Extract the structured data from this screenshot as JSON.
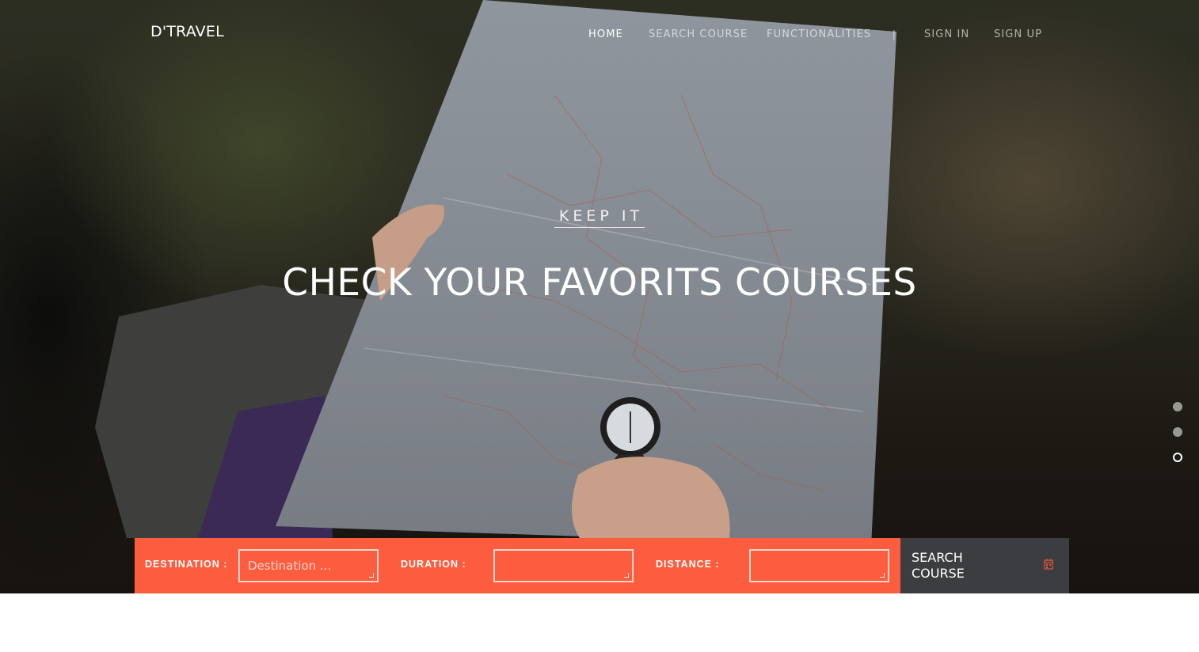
{
  "brand": {
    "logo": "D'TRAVEL"
  },
  "nav": {
    "items": [
      {
        "label": "HOME",
        "active": true
      },
      {
        "label": "SEARCH COURSE",
        "active": false
      },
      {
        "label": "FUNCTIONALITIES",
        "active": false
      }
    ],
    "separator": "|",
    "auth": [
      {
        "label": "SIGN IN"
      },
      {
        "label": "SIGN UP"
      }
    ]
  },
  "hero": {
    "eyebrow": "KEEP IT",
    "headline": "CHECK YOUR FAVORITS COURSES",
    "slides": {
      "count": 3,
      "active_index": 2
    }
  },
  "search": {
    "destination": {
      "label": "DESTINATION :",
      "placeholder": "Destination ...",
      "value": ""
    },
    "duration": {
      "label": "DURATION :",
      "placeholder": "",
      "value": ""
    },
    "distance": {
      "label": "DISTANCE :",
      "placeholder": "",
      "value": ""
    },
    "button": {
      "label": "SEARCH COURSE",
      "icon": "calendar-icon"
    }
  },
  "colors": {
    "accent": "#fc5d3e",
    "button_bg": "#3b3d40",
    "text_light": "#ffffff"
  }
}
